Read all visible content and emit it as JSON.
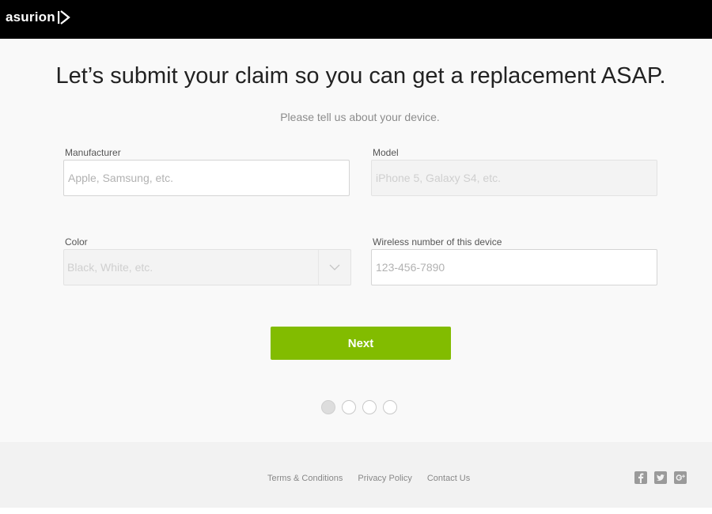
{
  "brand": {
    "name": "asurion",
    "logo_icon": "asurion-chevron-logo"
  },
  "headline": "Let’s submit your claim so you can get a replacement ASAP.",
  "subheadline": "Please tell us about your device.",
  "form": {
    "manufacturer": {
      "label": "Manufacturer",
      "placeholder": "Apple, Samsung, etc.",
      "value": ""
    },
    "model": {
      "label": "Model",
      "placeholder": "iPhone 5, Galaxy S4, etc.",
      "value": "",
      "disabled": true
    },
    "color": {
      "label": "Color",
      "placeholder": "Black, White, etc.",
      "disabled": true,
      "icon": "chevron-down-icon"
    },
    "wireless_number": {
      "label": "Wireless number of this device",
      "placeholder": "123-456-7890",
      "value": ""
    }
  },
  "next_button": {
    "label": "Next",
    "color": "#82bc00"
  },
  "progress": {
    "total_steps": 4,
    "current_step": 1
  },
  "footer": {
    "links": [
      "Terms & Conditions",
      "Privacy Policy",
      "Contact Us"
    ],
    "social": [
      "facebook-icon",
      "twitter-icon",
      "google-plus-icon"
    ]
  },
  "colors": {
    "topbar": "#000000",
    "accent": "#82bc00",
    "page_bg": "#f9f9f9",
    "footer_bg": "#f2f2f2"
  }
}
